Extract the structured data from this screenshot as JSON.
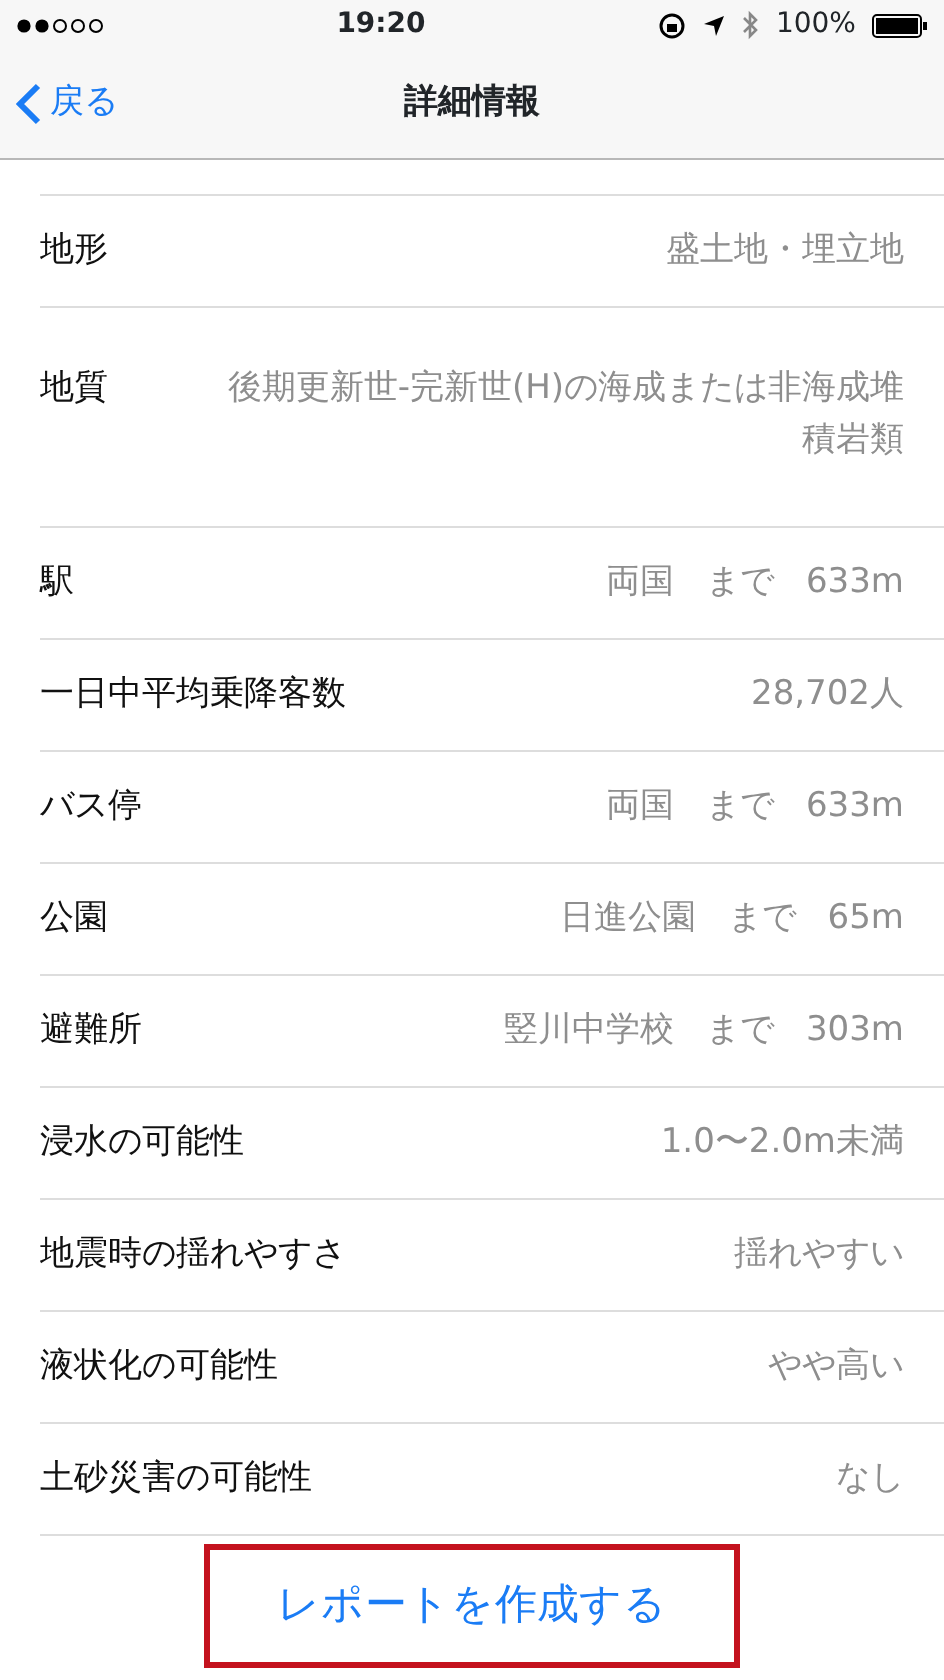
{
  "status_bar": {
    "time": "19:20",
    "battery": "100%"
  },
  "nav": {
    "back": "戻る",
    "title": "詳細情報"
  },
  "rows": [
    {
      "label": "地形",
      "value": "盛土地・埋立地"
    },
    {
      "label": "地質",
      "value": "後期更新世-完新世(H)の海成または非海成堆積岩類",
      "kind": "multi"
    },
    {
      "label": "駅",
      "value": "両国",
      "to": "まで",
      "distance": "633m"
    },
    {
      "label": "一日中平均乗降客数",
      "value": "28,702人"
    },
    {
      "label": "バス停",
      "value": "両国",
      "to": "まで",
      "distance": "633m"
    },
    {
      "label": "公園",
      "value": "日進公園",
      "to": "まで",
      "distance": "65m"
    },
    {
      "label": "避難所",
      "value": "竪川中学校",
      "to": "まで",
      "distance": "303m"
    },
    {
      "label": "浸水の可能性",
      "value": "1.0〜2.0m未満"
    },
    {
      "label": "地震時の揺れやすさ",
      "value": "揺れやすい"
    },
    {
      "label": "液状化の可能性",
      "value": "やや高い"
    },
    {
      "label": "土砂災害の可能性",
      "value": "なし"
    }
  ],
  "report_button": "レポートを作成する"
}
